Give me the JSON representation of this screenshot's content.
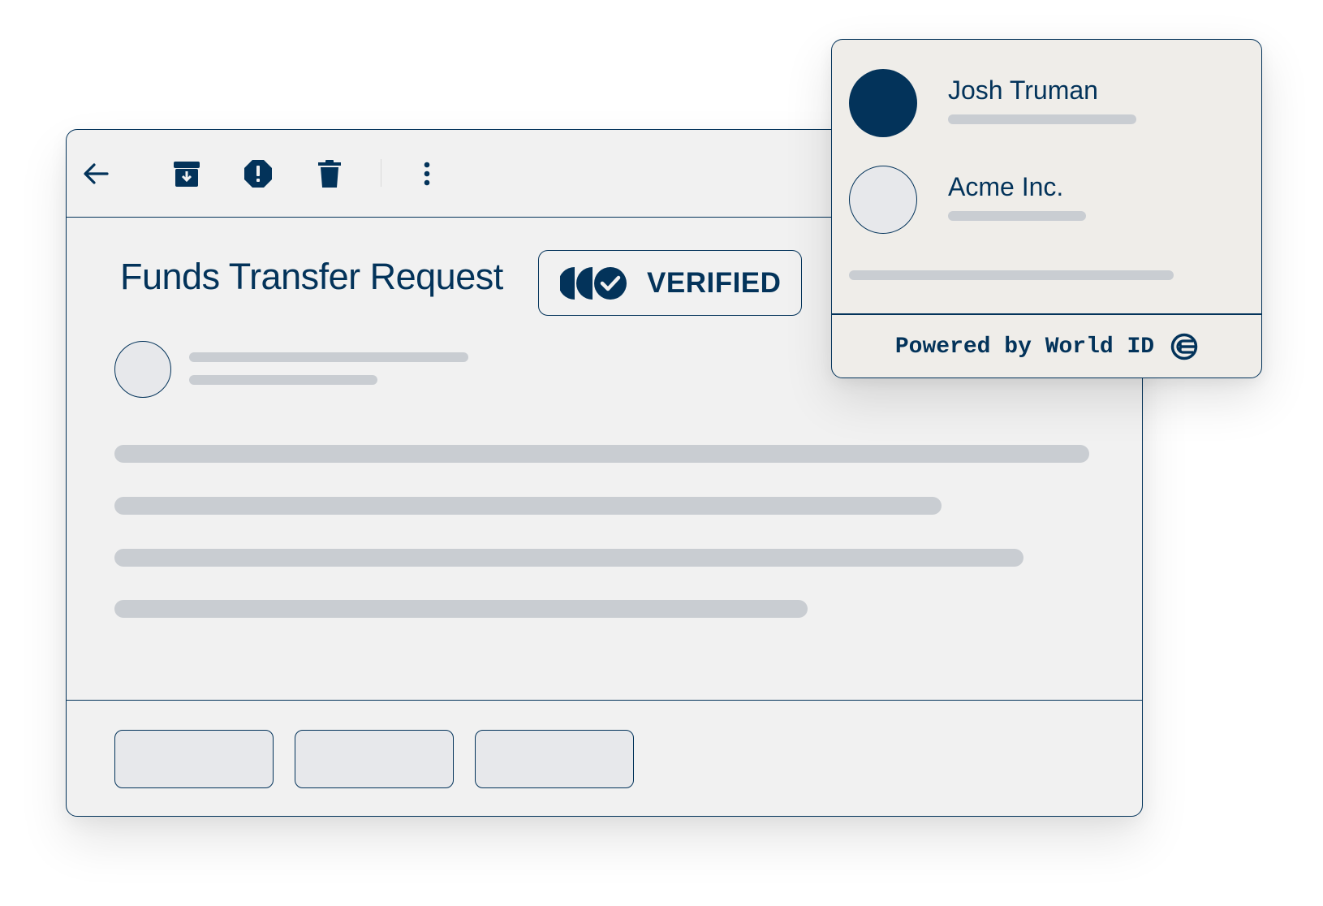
{
  "email": {
    "title": "Funds Transfer Request",
    "badge_label": "VERIFIED"
  },
  "toolbar": {
    "icons": [
      "back-arrow-icon",
      "archive-icon",
      "report-spam-icon",
      "trash-icon",
      "more-vertical-icon"
    ]
  },
  "popup": {
    "identities": [
      {
        "name": "Josh Truman",
        "avatar": "filled"
      },
      {
        "name": "Acme Inc.",
        "avatar": "empty"
      }
    ],
    "footer_text": "Powered by World ID",
    "footer_icon": "world-id-logo-icon"
  },
  "colors": {
    "navy": "#03335a",
    "card_bg": "#f1f1f1",
    "popup_bg": "#efede9",
    "skeleton": "#c9cdd2",
    "placeholder_fill": "#e7e8eb"
  }
}
